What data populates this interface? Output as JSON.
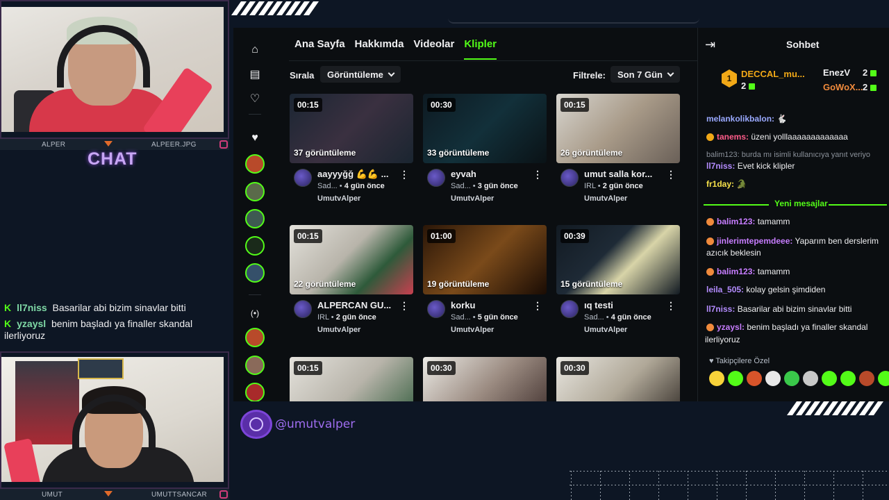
{
  "overlay": {
    "streamer_top": "ALPER",
    "streamer_top_handle": "ALPEER.JPG",
    "streamer_bottom": "UMUT",
    "streamer_bottom_handle": "UMUTTSANCAR",
    "chat_heading": "CHAT",
    "chat_messages": [
      {
        "user": "ll7niss",
        "text": "Basarilar abi bizim sinavlar bitti"
      },
      {
        "user": "yzaysl",
        "text": "benim başladı ya finaller skandal ilerliyoruz"
      }
    ],
    "handle": "@umutvalper"
  },
  "nav": {
    "tabs": [
      "Ana Sayfa",
      "Hakkımda",
      "Videolar",
      "Klipler"
    ],
    "active_tab": "Klipler",
    "live_icon": "(•)"
  },
  "filters": {
    "sort_label": "Sırala",
    "sort_value": "Görüntüleme",
    "filter_label": "Filtrele:",
    "filter_value": "Son 7 Gün"
  },
  "clips": [
    {
      "duration": "00:15",
      "views": "37 görüntüleme",
      "title": "aayyyğğ 💪💪 ...",
      "category": "Sad...",
      "age": "4 gün önce",
      "channel": "UmutvAlper"
    },
    {
      "duration": "00:30",
      "views": "33 görüntüleme",
      "title": "eyvah",
      "category": "Sad...",
      "age": "3 gün önce",
      "channel": "UmutvAlper"
    },
    {
      "duration": "00:15",
      "views": "26 görüntüleme",
      "title": "umut salla kor...",
      "category": "IRL",
      "age": "2 gün önce",
      "channel": "UmutvAlper"
    },
    {
      "duration": "00:15",
      "views": "22 görüntüleme",
      "title": "ALPERCAN GU...",
      "category": "IRL",
      "age": "2 gün önce",
      "channel": "UmutvAlper"
    },
    {
      "duration": "01:00",
      "views": "19 görüntüleme",
      "title": "korku",
      "category": "Sad...",
      "age": "5 gün önce",
      "channel": "UmutvAlper"
    },
    {
      "duration": "00:39",
      "views": "15 görüntüleme",
      "title": "ıq testi",
      "category": "Sad...",
      "age": "4 gün önce",
      "channel": "UmutvAlper"
    },
    {
      "duration": "00:15"
    },
    {
      "duration": "00:30"
    },
    {
      "duration": "00:30"
    }
  ],
  "chat": {
    "title": "Sohbet",
    "gifters": [
      {
        "rank": "1",
        "name": "DECCAL_mu...",
        "count": "2"
      },
      {
        "rank": "",
        "name": "EnezV",
        "count": "2"
      },
      {
        "rank": "",
        "name": "GoWoX...",
        "count": "2"
      }
    ],
    "messages": [
      {
        "user": "melankolikbalon:",
        "text": "🐇"
      },
      {
        "user": "tanems:",
        "text": "üzeni yolllaaaaaaaaaaaaa"
      },
      {
        "reply": "balim123: burda mı isimli kullanıcıya yanıt veriyo"
      },
      {
        "user": "ll7niss:",
        "text": "Evet kick klipler"
      },
      {
        "user": "fr1day:",
        "text": "🐊"
      }
    ],
    "new_messages_label": "Yeni mesajlar",
    "new_messages": [
      {
        "user": "balim123:",
        "text": "tamamm"
      },
      {
        "user": "jinlerimtepemdeee:",
        "text": "Yaparım ben derslerim",
        "text2": "azıcık beklesin"
      },
      {
        "user": "balim123:",
        "text": "tamamm"
      },
      {
        "user": "leila_505:",
        "text": "kolay gelsin şimdiden"
      },
      {
        "user": "ll7niss:",
        "text": "Basarilar abi bizim sinavlar bitti"
      },
      {
        "user": "yzaysl:",
        "text": "benim başladı ya finaller skandal",
        "text2": "ilerliyoruz"
      }
    ],
    "followers_only": "Takipçilere Özel"
  },
  "colors": {
    "kick_green": "#53fc18",
    "accent_purple": "#9f6df0",
    "background": "#0d1624"
  }
}
